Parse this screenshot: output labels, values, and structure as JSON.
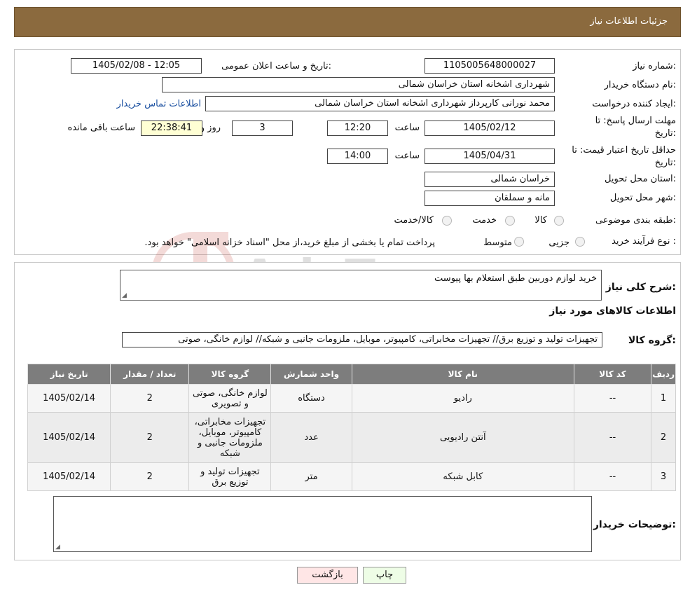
{
  "header": {
    "title": "جزئیات اطلاعات نیاز"
  },
  "form": {
    "need_number_label": "شماره نیاز:",
    "need_number": "1105005648000027",
    "announce_label": "تاریخ و ساعت اعلان عمومی:",
    "announce_value": "1405/02/08 - 12:05",
    "buyer_org_label": "نام دستگاه خریدار:",
    "buyer_org": "شهرداری اشخانه استان خراسان شمالی",
    "creator_label": "ایجاد کننده درخواست:",
    "creator": "محمد نورانی کارپرداز شهرداری اشخانه استان خراسان شمالی",
    "contact_link": "اطلاعات تماس خریدار",
    "deadline_label": "مهلت ارسال پاسخ: تا",
    "deadline_label2": "تاریخ:",
    "deadline_date": "1405/02/12",
    "time_label": "ساعت",
    "deadline_time": "12:20",
    "days_value": "3",
    "days_label": "روز و",
    "remaining_time": "22:38:41",
    "remaining_label": "ساعت باقی مانده",
    "validity_label": "حداقل تاریخ اعتبار قیمت: تا",
    "validity_label2": "تاریخ:",
    "validity_date": "1405/04/31",
    "validity_time": "14:00",
    "province_label": "استان محل تحویل:",
    "province": "خراسان شمالی",
    "city_label": "شهر محل تحویل:",
    "city": "مانه و سملقان",
    "category_label": "طبقه بندی موضوعی:",
    "category_options": [
      "کالا",
      "خدمت",
      "کالا/خدمت"
    ],
    "process_label": "نوع فرآیند خرید :",
    "process_options": [
      "جزیی",
      "متوسط"
    ],
    "process_note": "پرداخت تمام یا بخشی از مبلغ خرید،از محل \"اسناد خزانه اسلامی\" خواهد بود."
  },
  "details": {
    "summary_label": "شرح کلی نیاز:",
    "summary": "خرید لوازم دوربین طبق استعلام بها پیوست",
    "goods_info_title": "اطلاعات کالاهای مورد نیاز",
    "group_label": "گروه کالا:",
    "group_value": "تجهیزات تولید و توزیع برق// تجهیزات مخابراتی، کامپیوتر، موبایل، ملزومات جانبی و شبکه// لوازم خانگی، صوتی",
    "table": {
      "headers": [
        "ردیف",
        "کد کالا",
        "نام کالا",
        "واحد شمارش",
        "گروه کالا",
        "تعداد / مقدار",
        "تاریخ نیاز"
      ],
      "rows": [
        [
          "1",
          "--",
          "رادیو",
          "دستگاه",
          "لوازم خانگی، صوتی و تصویری",
          "2",
          "1405/02/14"
        ],
        [
          "2",
          "--",
          "آنتن رادیویی",
          "عدد",
          "تجهیزات مخابراتی، کامپیوتر، موبایل، ملزومات جانبی و شبکه",
          "2",
          "1405/02/14"
        ],
        [
          "3",
          "--",
          "کابل شبکه",
          "متر",
          "تجهیزات تولید و توزیع برق",
          "2",
          "1405/02/14"
        ]
      ]
    },
    "buyer_notes_label": "توضیحات خریدار:",
    "buyer_notes": ""
  },
  "buttons": {
    "print": "چاپ",
    "back": "بازگشت"
  },
  "colors": {
    "header_bg": "#8b6a3e",
    "table_header_bg": "#7d7d7d",
    "print_bg": "#eefde6",
    "back_bg": "#ffe6e6"
  }
}
